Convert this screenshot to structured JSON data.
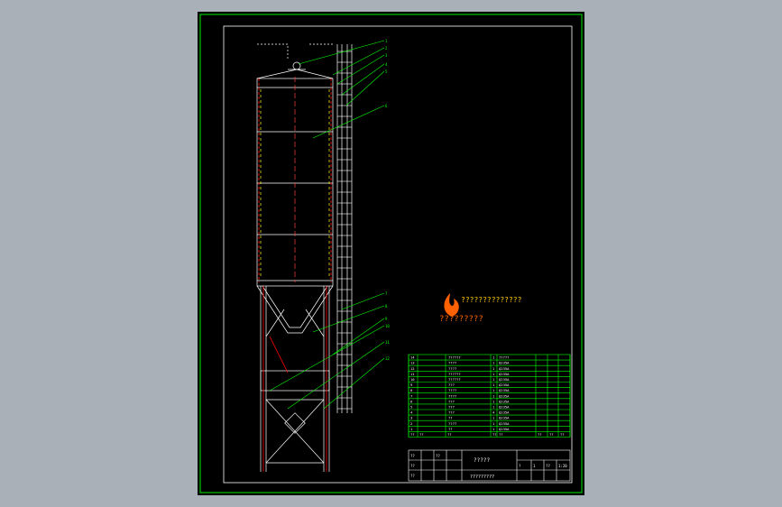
{
  "colors": {
    "viewport_bg": "#a9b0b8",
    "sheet_bg": "#000000",
    "border": "#00c800",
    "structure": "#ffffff",
    "weld": "#ff0000",
    "hidden_line": "#ffff00",
    "leader": "#00ff00",
    "logo_flame": "#ff6000",
    "logo_text": "#ffcc00",
    "logo_subtitle": "#ff6600"
  },
  "logo": {
    "text": "??????????????",
    "subtitle": "?????????",
    "icon": "flame-logo-icon"
  },
  "balloons": [
    "1",
    "2",
    "3",
    "4",
    "5",
    "6",
    "7",
    "8",
    "9",
    "10",
    "11",
    "12"
  ],
  "bom_rows": [
    {
      "no": "14",
      "name": "??????",
      "qty": "1",
      "material": "?????"
    },
    {
      "no": "13",
      "name": "????",
      "qty": "1",
      "material": "Q235A"
    },
    {
      "no": "12",
      "name": "????",
      "qty": "1",
      "material": "Q235A"
    },
    {
      "no": "11",
      "name": "??????",
      "qty": "1",
      "material": "Q235A"
    },
    {
      "no": "10",
      "name": "??????",
      "qty": "1",
      "material": "Q235A"
    },
    {
      "no": "9",
      "name": "???",
      "qty": "1",
      "material": "Q235A"
    },
    {
      "no": "8",
      "name": "????",
      "qty": "1",
      "material": "Q235A"
    },
    {
      "no": "7",
      "name": "????",
      "qty": "1",
      "material": "Q235A"
    },
    {
      "no": "6",
      "name": "???",
      "qty": "1",
      "material": "Q235A"
    },
    {
      "no": "5",
      "name": "???",
      "qty": "1",
      "material": "Q235A"
    },
    {
      "no": "4",
      "name": "???",
      "qty": "4",
      "material": "Q235A"
    },
    {
      "no": "3",
      "name": "??",
      "qty": "1",
      "material": "Q235A"
    },
    {
      "no": "2",
      "name": "????",
      "qty": "1",
      "material": "Q235A"
    },
    {
      "no": "1",
      "name": "??",
      "qty": "1",
      "material": "Q235A"
    }
  ],
  "bom_header": [
    "??",
    "??",
    "??",
    "??",
    "??",
    "??",
    "??",
    "??"
  ],
  "title_block": {
    "drawing_title": "?????",
    "company": "?????????",
    "scale_label": "??",
    "scale": "1:20",
    "sheet_label": "?",
    "sheet_no": "1",
    "drawn_by": "??",
    "checked_by": "??",
    "approved_by": "??",
    "date": "??"
  }
}
